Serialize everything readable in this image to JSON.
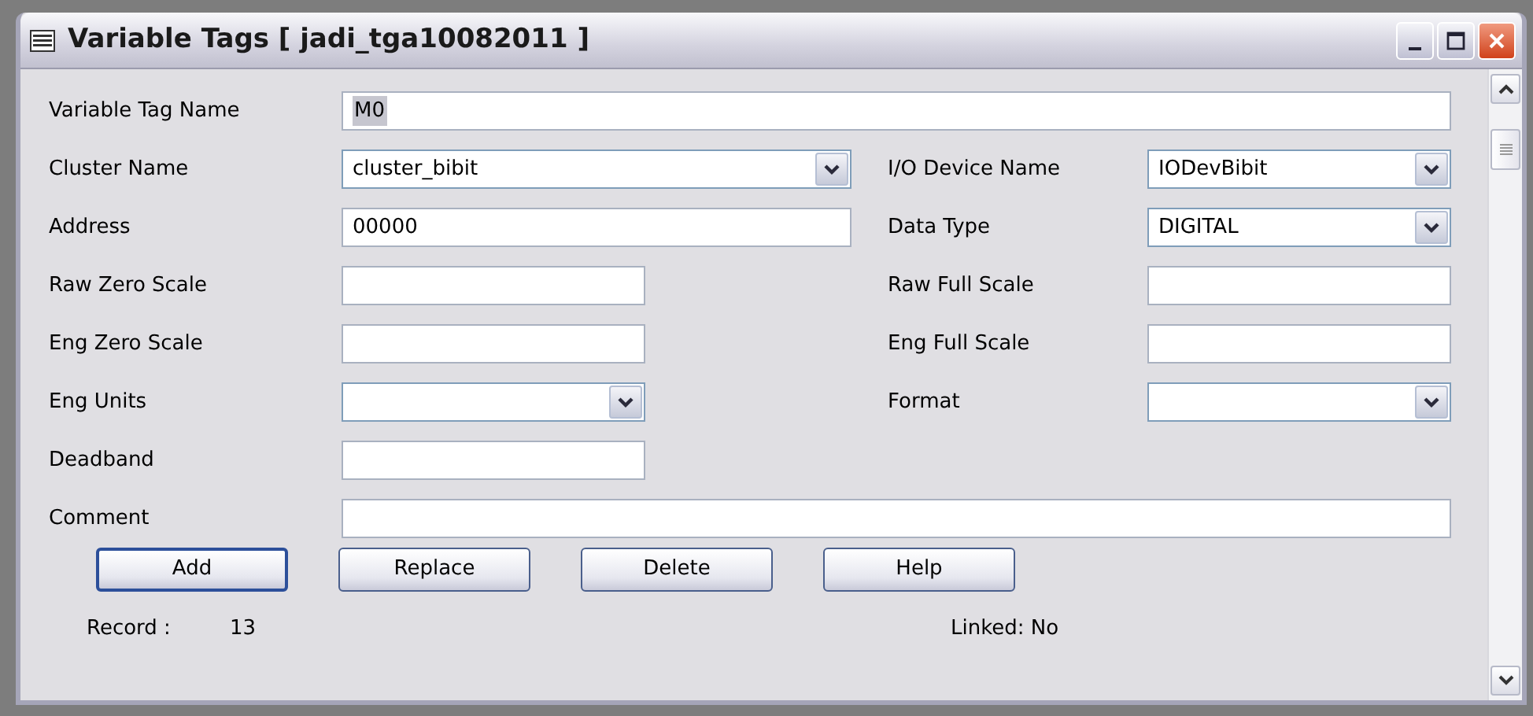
{
  "window": {
    "title": "Variable Tags [ jadi_tga10082011 ]"
  },
  "rows": [
    {
      "cells": [
        {
          "label": "Variable Tag Name",
          "kind": "longtext",
          "value": "M0",
          "selected": true
        }
      ]
    },
    {
      "cells": [
        {
          "label": "Cluster Name",
          "kind": "combo",
          "value": "cluster_bibit"
        },
        {
          "label": "I/O Device Name",
          "kind": "combo",
          "value": "IODevBibit"
        }
      ]
    },
    {
      "cells": [
        {
          "label": "Address",
          "kind": "text",
          "value": "00000"
        },
        {
          "label": "Data Type",
          "kind": "combo",
          "value": "DIGITAL"
        }
      ]
    },
    {
      "cells": [
        {
          "label": "Raw Zero Scale",
          "kind": "shorttext"
        },
        {
          "label": "Raw Full Scale",
          "kind": "text"
        }
      ]
    },
    {
      "cells": [
        {
          "label": "Eng Zero Scale",
          "kind": "shorttext"
        },
        {
          "label": "Eng Full Scale",
          "kind": "text"
        }
      ]
    },
    {
      "cells": [
        {
          "label": "Eng Units",
          "kind": "shortcombo"
        },
        {
          "label": "Format",
          "kind": "combo"
        }
      ]
    },
    {
      "cells": [
        {
          "label": "Deadband",
          "kind": "shorttext"
        }
      ]
    },
    {
      "cells": [
        {
          "label": "Comment",
          "kind": "longtext"
        }
      ]
    }
  ],
  "buttons": [
    {
      "label": "Add",
      "default": true
    },
    {
      "label": "Replace",
      "default": false
    },
    {
      "label": "Delete",
      "default": false
    },
    {
      "label": "Help",
      "default": false
    }
  ],
  "status": {
    "record_label": "Record :",
    "record_value": "13",
    "linked": "Linked: No"
  }
}
